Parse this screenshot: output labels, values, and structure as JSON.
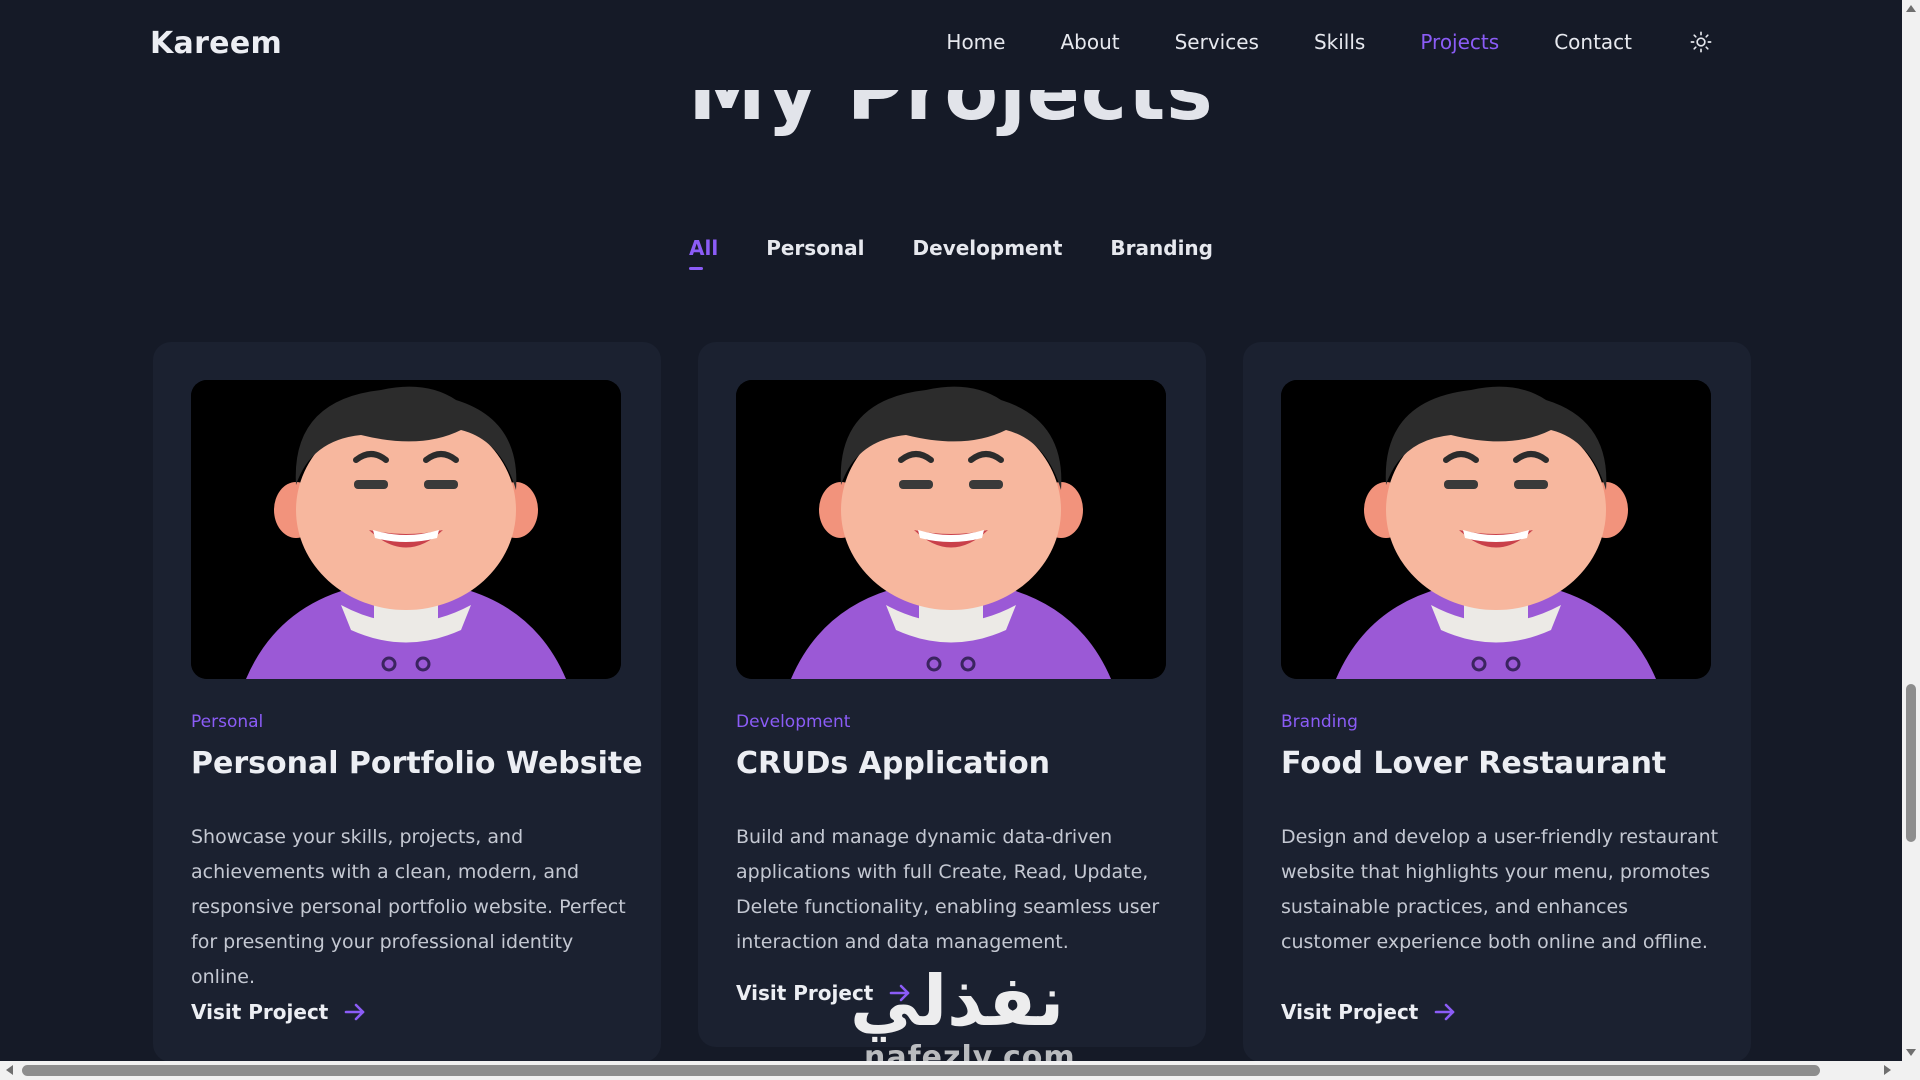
{
  "header": {
    "logo": "Kareem",
    "nav": [
      {
        "label": "Home"
      },
      {
        "label": "About"
      },
      {
        "label": "Services"
      },
      {
        "label": "Skills"
      },
      {
        "label": "Projects",
        "active": true
      },
      {
        "label": "Contact"
      }
    ],
    "theme_toggle_icon": "sun-icon"
  },
  "section": {
    "title": "My Projects"
  },
  "filters": [
    {
      "label": "All",
      "active": true
    },
    {
      "label": "Personal"
    },
    {
      "label": "Development"
    },
    {
      "label": "Branding"
    }
  ],
  "projects": [
    {
      "category": "Personal",
      "title": "Personal Portfolio Website",
      "description": "Showcase your skills, projects, and achievements with a clean, modern, and responsive personal portfolio website. Perfect for presenting your professional identity online.",
      "link_label": "Visit Project"
    },
    {
      "category": "Development",
      "title": "CRUDs Application",
      "description": "Build and manage dynamic data-driven applications with full Create, Read, Update, Delete functionality, enabling seamless user interaction and data management.",
      "link_label": "Visit Project"
    },
    {
      "category": "Branding",
      "title": "Food Lover Restaurant",
      "description": "Design and develop a user-friendly restaurant website that highlights your menu, promotes sustainable practices, and enhances customer experience both online and offline.",
      "link_label": "Visit Project"
    }
  ],
  "watermark": {
    "arabic": "نفذلي",
    "latin": "nafezly.com"
  },
  "colors": {
    "background": "#151a27",
    "card": "#1b2130",
    "accent": "#8b5cf6",
    "text": "#e6e8ee"
  }
}
